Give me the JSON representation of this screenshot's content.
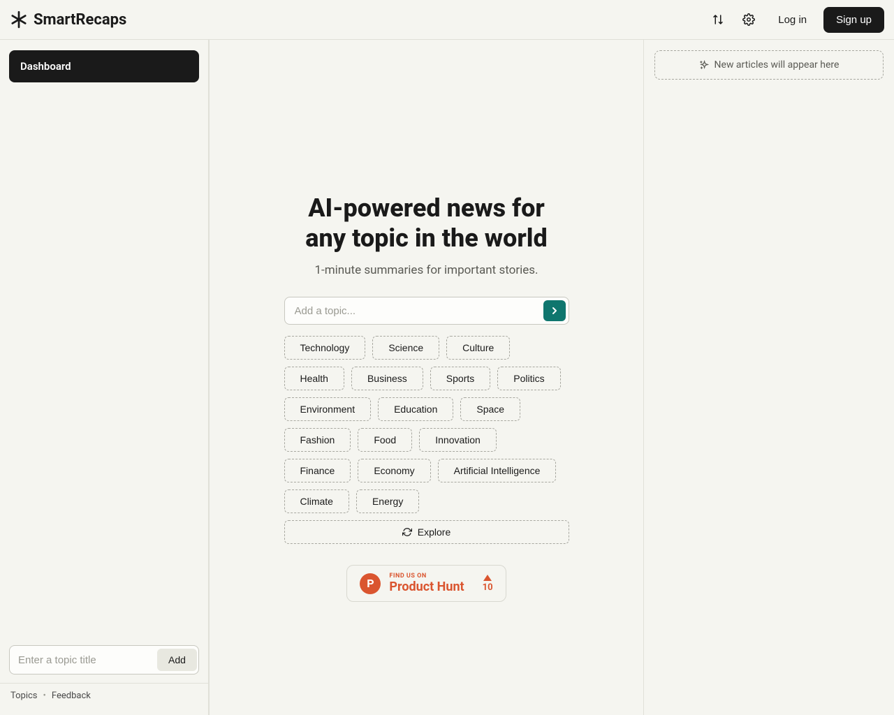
{
  "header": {
    "brand": "SmartRecaps",
    "login": "Log in",
    "signup": "Sign up"
  },
  "sidebar": {
    "dashboard": "Dashboard",
    "add_topic_placeholder": "Enter a topic title",
    "add_button": "Add",
    "footer": {
      "topics": "Topics",
      "feedback": "Feedback"
    }
  },
  "main": {
    "title_line1": "AI-powered news for",
    "title_line2": "any topic in the world",
    "subtitle": "1-minute summaries for important stories.",
    "topic_placeholder": "Add a topic...",
    "chips": [
      "Technology",
      "Science",
      "Culture",
      "Health",
      "Business",
      "Sports",
      "Politics",
      "Environment",
      "Education",
      "Space",
      "Fashion",
      "Food",
      "Innovation",
      "Finance",
      "Economy",
      "Artificial Intelligence",
      "Climate",
      "Energy"
    ],
    "explore": "Explore",
    "ph": {
      "find_us": "FIND US ON",
      "name": "Product Hunt",
      "votes": "10"
    }
  },
  "right": {
    "placeholder": "New articles will appear here"
  }
}
